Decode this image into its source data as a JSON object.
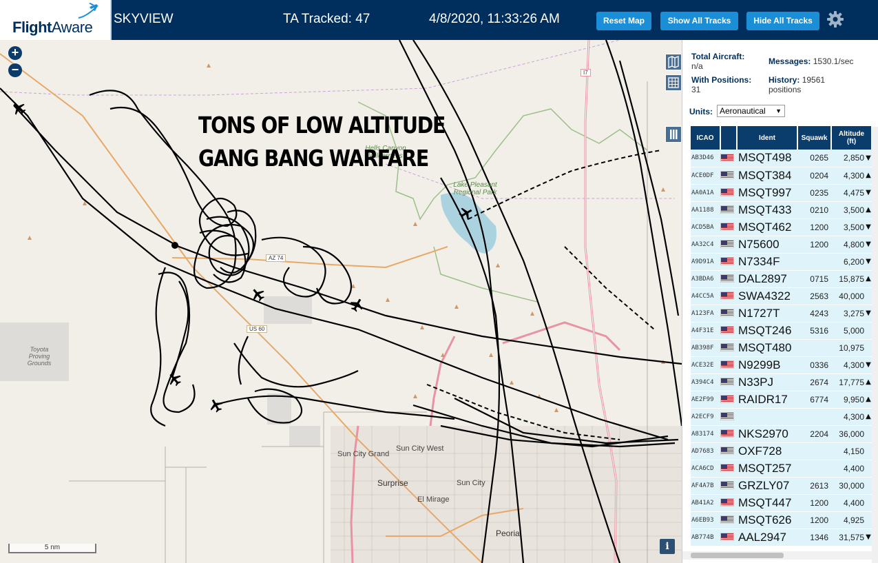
{
  "header": {
    "logo_flight": "Flight",
    "logo_aware": "Aware",
    "title": "SKYVIEW",
    "tracked": "TA Tracked: 47",
    "datetime": "4/8/2020, 11:33:26 AM",
    "reset_map": "Reset Map",
    "show_all": "Show All Tracks",
    "hide_all": "Hide All Tracks"
  },
  "map": {
    "zoom_in": "+",
    "zoom_out": "−",
    "overlay_line1": "TONS OF LOW ALTITUDE",
    "overlay_line2": "GANG BANG WARFARE",
    "scale_label": "5 nm",
    "info": "i",
    "labels": {
      "sun_city_grand": "Sun City Grand",
      "sun_city_west": "Sun City West",
      "surprise": "Surprise",
      "sun_city": "Sun City",
      "el_mirage": "El Mirage",
      "peoria": "Peoria",
      "toyota": "Toyota Proving Grounds",
      "lake_pleasant": "Lake Pleasant Regional Park",
      "hells_canyon": "Hells Canyon Wilderness",
      "az74": "AZ 74",
      "us60": "US 60",
      "i17": "I7"
    }
  },
  "stats": {
    "total_aircraft_label": "Total Aircraft:",
    "total_aircraft_value": "n/a",
    "with_positions_label": "With Positions:",
    "with_positions_value": "31",
    "messages_label": "Messages:",
    "messages_value": "1530.1/sec",
    "history_label": "History:",
    "history_value": "19561",
    "history_unit": "positions"
  },
  "units": {
    "label": "Units:",
    "selected": "Aeronautical"
  },
  "table": {
    "headers": {
      "icao": "ICAO",
      "ident": "Ident",
      "squawk": "Squawk",
      "altitude": "Altitude",
      "altitude_unit": "(ft)"
    },
    "rows": [
      {
        "icao": "AB3D46",
        "ident": "MSQT498",
        "squawk": "0265",
        "alt": "2,850",
        "trend": "▼"
      },
      {
        "icao": "ACE0DF",
        "ident": "MSQT384",
        "squawk": "0204",
        "alt": "4,300",
        "trend": "▲"
      },
      {
        "icao": "AA0A1A",
        "ident": "MSQT997",
        "squawk": "0235",
        "alt": "4,475",
        "trend": "▼"
      },
      {
        "icao": "AA1188",
        "ident": "MSQT433",
        "squawk": "0210",
        "alt": "3,500",
        "trend": "▲"
      },
      {
        "icao": "ACD5BA",
        "ident": "MSQT462",
        "squawk": "1200",
        "alt": "3,500",
        "trend": "▼"
      },
      {
        "icao": "AA32C4",
        "ident": "N75600",
        "squawk": "1200",
        "alt": "4,800",
        "trend": "▼"
      },
      {
        "icao": "A9D91A",
        "ident": "N7334F",
        "squawk": "",
        "alt": "6,200",
        "trend": "▼"
      },
      {
        "icao": "A3BDA6",
        "ident": "DAL2897",
        "squawk": "0715",
        "alt": "15,875",
        "trend": "▲"
      },
      {
        "icao": "A4CC5A",
        "ident": "SWA4322",
        "squawk": "2563",
        "alt": "40,000",
        "trend": ""
      },
      {
        "icao": "A123FA",
        "ident": "N1727T",
        "squawk": "4243",
        "alt": "3,275",
        "trend": "▼"
      },
      {
        "icao": "A4F31E",
        "ident": "MSQT246",
        "squawk": "5316",
        "alt": "5,000",
        "trend": ""
      },
      {
        "icao": "AB398F",
        "ident": "MSQT480",
        "squawk": "",
        "alt": "10,975",
        "trend": ""
      },
      {
        "icao": "ACE32E",
        "ident": "N9299B",
        "squawk": "0336",
        "alt": "4,300",
        "trend": "▼"
      },
      {
        "icao": "A394C4",
        "ident": "N33PJ",
        "squawk": "2674",
        "alt": "17,775",
        "trend": "▲"
      },
      {
        "icao": "AE2F99",
        "ident": "RAIDR17",
        "squawk": "6774",
        "alt": "9,950",
        "trend": "▲"
      },
      {
        "icao": "A2ECF9",
        "ident": "",
        "squawk": "",
        "alt": "4,300",
        "trend": "▲"
      },
      {
        "icao": "A83174",
        "ident": "NKS2970",
        "squawk": "2204",
        "alt": "36,000",
        "trend": ""
      },
      {
        "icao": "AD7683",
        "ident": "OXF728",
        "squawk": "",
        "alt": "4,150",
        "trend": ""
      },
      {
        "icao": "ACA6CD",
        "ident": "MSQT257",
        "squawk": "",
        "alt": "4,400",
        "trend": ""
      },
      {
        "icao": "AF4A7B",
        "ident": "GRZLY07",
        "squawk": "2613",
        "alt": "30,000",
        "trend": ""
      },
      {
        "icao": "AB41A2",
        "ident": "MSQT447",
        "squawk": "1200",
        "alt": "4,400",
        "trend": ""
      },
      {
        "icao": "A6EB93",
        "ident": "MSQT626",
        "squawk": "1200",
        "alt": "4,925",
        "trend": ""
      },
      {
        "icao": "AB774B",
        "ident": "AAL2947",
        "squawk": "1346",
        "alt": "31,575",
        "trend": "▼"
      }
    ]
  },
  "colors": {
    "header_bg": "#002f5d",
    "button_bg": "#1b8ed8",
    "table_header": "#0a3d6b",
    "row_bg": "#dff3fb",
    "map_bg": "#f2efe9"
  }
}
